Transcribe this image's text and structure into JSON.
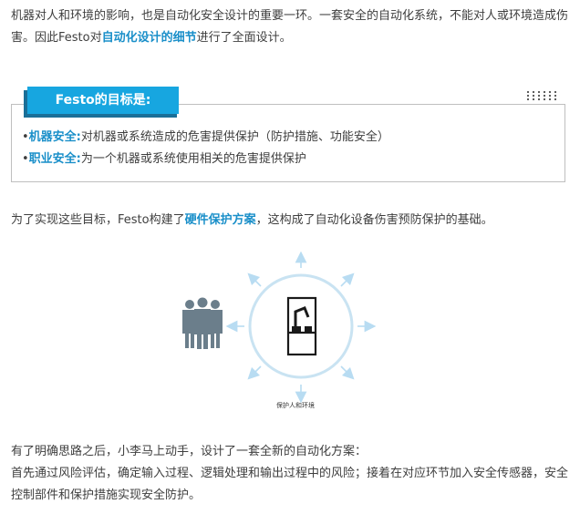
{
  "intro": {
    "text_before": "机器对人和环境的影响，也是自动化安全设计的重要一环。一套安全的自动化系统，不能对人或环境造成伤害。因此Festo对",
    "highlight": "自动化设计的细节",
    "text_after": "进行了全面设计。"
  },
  "goal_box": {
    "title": "Festo的目标是:",
    "items": [
      {
        "label": "机器安全:",
        "text": "对机器或系统造成的危害提供保护（防护措施、功能安全）"
      },
      {
        "label": "职业安全:",
        "text": "为一个机器或系统使用相关的危害提供保护"
      }
    ]
  },
  "para2": {
    "text_before": "为了实现这些目标，Festo构建了",
    "highlight": "硬件保护方案",
    "text_after": "，这构成了自动化设备伤害预防保护的基础。"
  },
  "figure": {
    "caption": "保护人和环境",
    "colors": {
      "ring": "#c9e3f2",
      "arrow": "#b8dcf2",
      "people": "#6b7e8b",
      "robot": "#1a1a1a"
    }
  },
  "para3": {
    "line1": "有了明确思路之后，小李马上动手，设计了一套全新的自动化方案：",
    "line2": "首先通过风险评估，确定输入过程、逻辑处理和输出过程中的风险；接着在对应环节加入安全传感器，安全控制部件和保护措施实现安全防护。"
  },
  "colors": {
    "accent": "#17a6e0",
    "highlight_text": "#1a8fc9",
    "body_text": "#3e3e3e"
  }
}
